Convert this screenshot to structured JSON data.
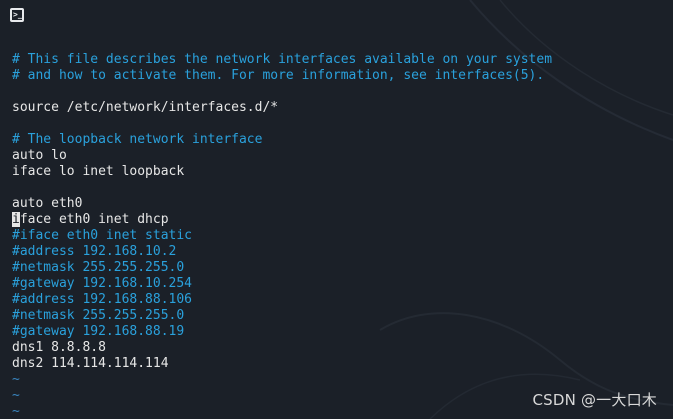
{
  "window": {
    "icon": "terminal-icon",
    "colors": {
      "background": "#1b2028",
      "comment": "#2aa1dc",
      "code": "#e6e6e6",
      "tilde": "#3a86c0"
    }
  },
  "editor": {
    "lines": [
      {
        "type": "empty",
        "text": ""
      },
      {
        "type": "comment",
        "text": "# This file describes the network interfaces available on your system"
      },
      {
        "type": "comment",
        "text": "# and how to activate them. For more information, see interfaces(5)."
      },
      {
        "type": "empty",
        "text": ""
      },
      {
        "type": "code",
        "text": "source /etc/network/interfaces.d/*"
      },
      {
        "type": "empty",
        "text": ""
      },
      {
        "type": "comment",
        "text": "# The loopback network interface"
      },
      {
        "type": "code",
        "text": "auto lo"
      },
      {
        "type": "code",
        "text": "iface lo inet loopback"
      },
      {
        "type": "empty",
        "text": ""
      },
      {
        "type": "code",
        "text": "auto eth0"
      },
      {
        "type": "cursor-line",
        "cursor_char": "i",
        "text": "face eth0 inet dhcp"
      },
      {
        "type": "comment",
        "text": "#iface eth0 inet static"
      },
      {
        "type": "comment",
        "text": "#address 192.168.10.2"
      },
      {
        "type": "comment",
        "text": "#netmask 255.255.255.0"
      },
      {
        "type": "comment",
        "text": "#gateway 192.168.10.254"
      },
      {
        "type": "comment",
        "text": "#address 192.168.88.106"
      },
      {
        "type": "comment",
        "text": "#netmask 255.255.255.0"
      },
      {
        "type": "comment",
        "text": "#gateway 192.168.88.19"
      },
      {
        "type": "code",
        "text": "dns1 8.8.8.8"
      },
      {
        "type": "code",
        "text": "dns2 114.114.114.114"
      },
      {
        "type": "tilde",
        "text": "~"
      },
      {
        "type": "tilde",
        "text": "~"
      },
      {
        "type": "tilde",
        "text": "~"
      },
      {
        "type": "tilde",
        "text": "~"
      }
    ]
  },
  "watermark": {
    "text": "CSDN @一大口木"
  }
}
